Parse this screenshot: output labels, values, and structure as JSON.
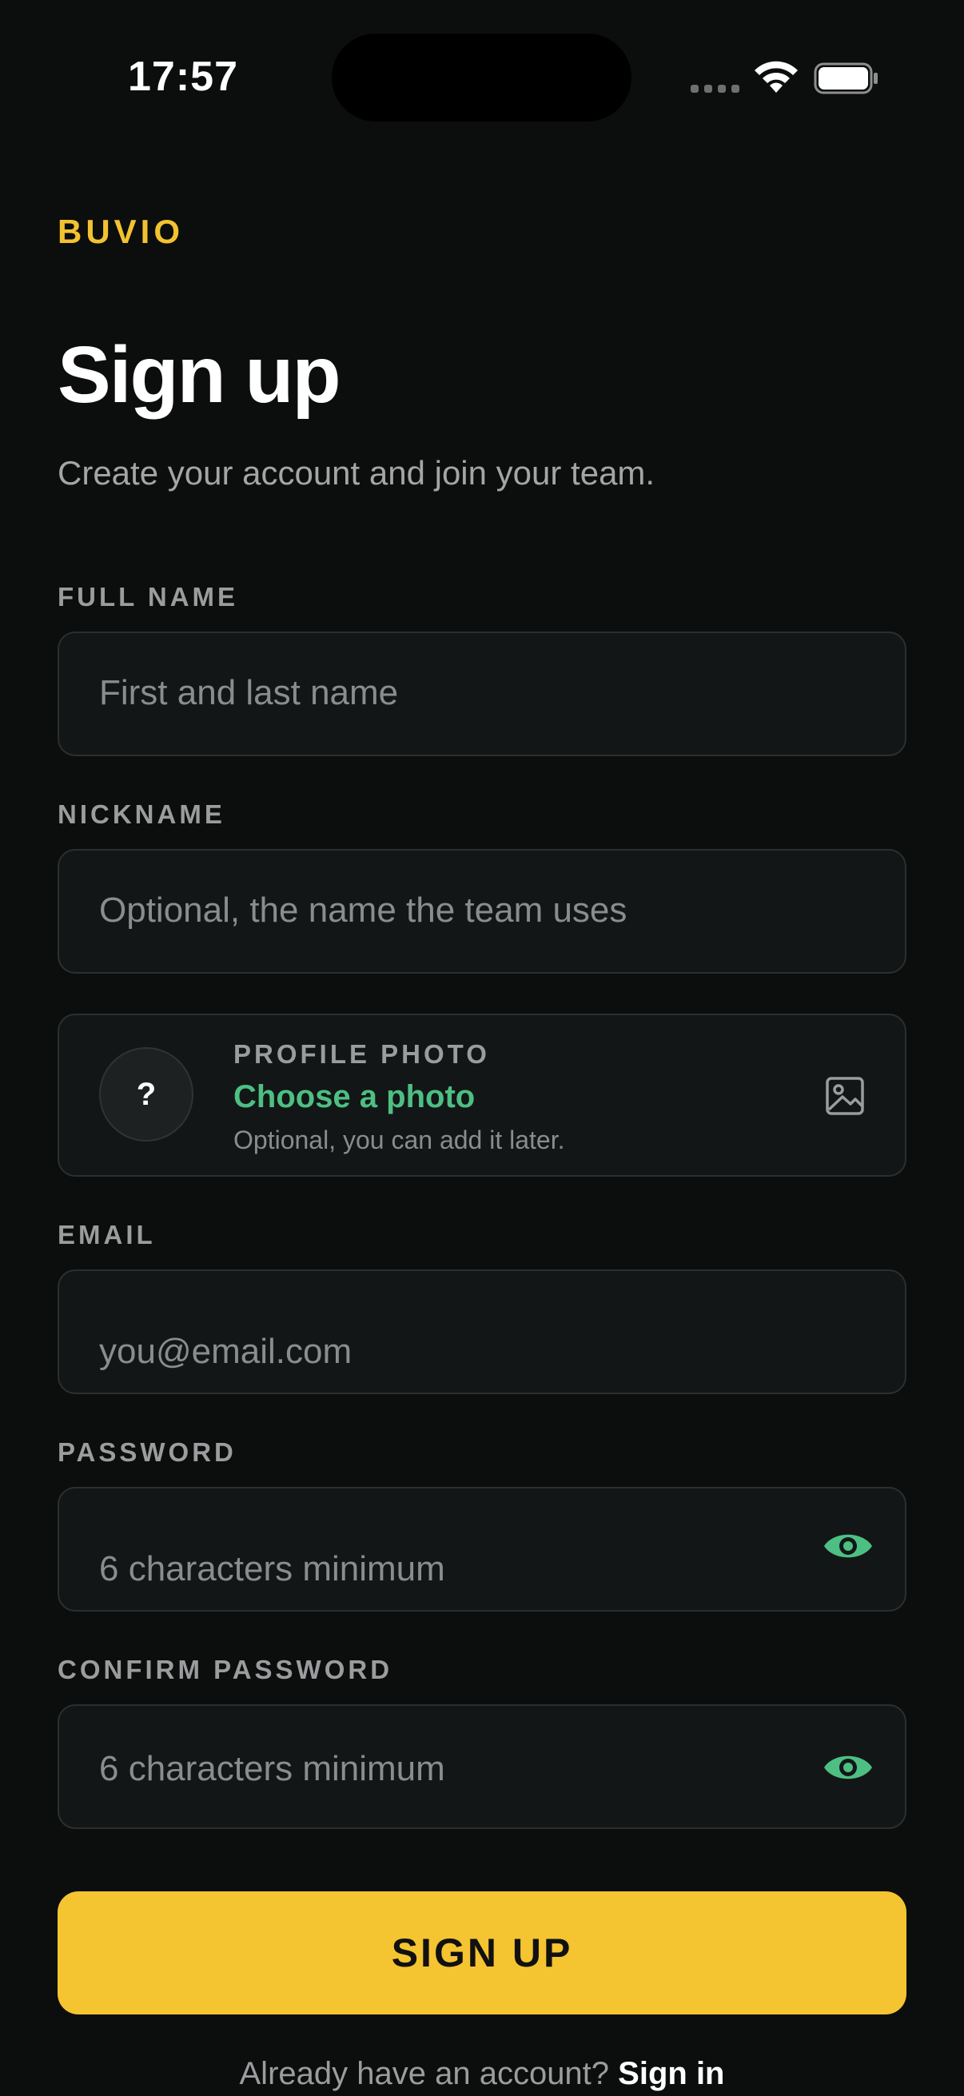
{
  "status_bar": {
    "time": "17:57"
  },
  "brand": "BUVIO",
  "title": "Sign up",
  "subtitle": "Create your account and join your team.",
  "fields": {
    "full_name": {
      "label": "FULL NAME",
      "value": "",
      "placeholder": "First and last name"
    },
    "nickname": {
      "label": "NICKNAME",
      "value": "",
      "placeholder": "Optional, the name the team uses"
    },
    "email": {
      "label": "EMAIL",
      "value": "",
      "placeholder": "you@email.com"
    },
    "password": {
      "label": "PASSWORD",
      "value": "",
      "placeholder": "6 characters minimum"
    },
    "confirm_password": {
      "label": "CONFIRM PASSWORD",
      "value": "",
      "placeholder": "6 characters minimum"
    }
  },
  "profile_photo": {
    "label": "PROFILE PHOTO",
    "avatar_placeholder": "?",
    "action": "Choose a photo",
    "hint": "Optional, you can add it later."
  },
  "signup_button": "SIGN UP",
  "signin_prompt": {
    "text": "Already have an account?",
    "link": "Sign in"
  },
  "icons": {
    "password_toggle": "eye-icon",
    "photo": "image-icon"
  },
  "colors": {
    "background": "#0c0d0d",
    "accent": "#f4c431",
    "link_green": "#4dbf83",
    "field_background": "#131616",
    "field_border": "#2c2f30"
  }
}
